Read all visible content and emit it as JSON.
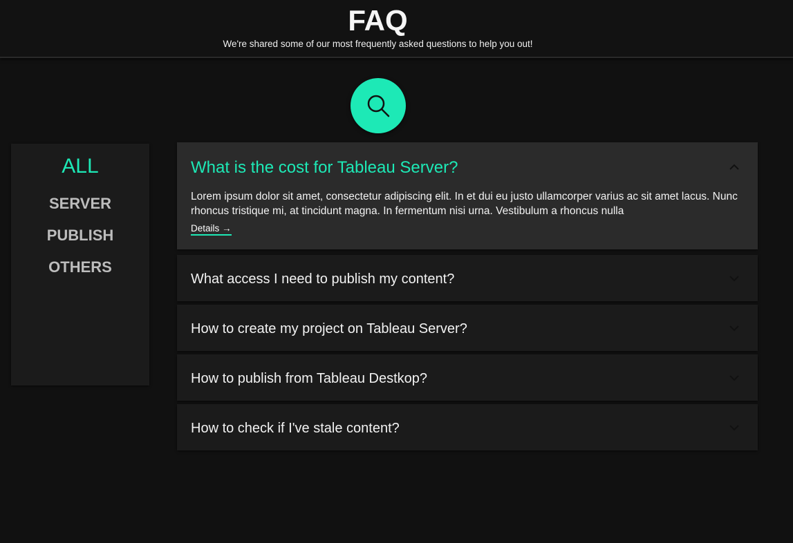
{
  "header": {
    "title": "FAQ",
    "subtitle": "We're shared some of our most frequently asked questions to help you out!"
  },
  "search": {
    "icon": "search-icon",
    "color": "#1de9b6"
  },
  "categories": [
    {
      "label": "ALL",
      "active": true
    },
    {
      "label": "SERVER",
      "active": false
    },
    {
      "label": "PUBLISH",
      "active": false
    },
    {
      "label": "OTHERS",
      "active": false
    }
  ],
  "faqs": [
    {
      "question": "What is the cost for Tableau Server?",
      "expanded": true,
      "answer": "Lorem ipsum dolor sit amet, consectetur adipiscing elit. In et dui eu justo ullamcorper varius ac sit amet lacus. Nunc rhoncus tristique mi, at tincidunt magna. In fermentum nisi urna. Vestibulum a rhoncus nulla",
      "details_label": "Details →"
    },
    {
      "question": "What access I need to publish my content?",
      "expanded": false
    },
    {
      "question": "How to create my project on Tableau Server?",
      "expanded": false
    },
    {
      "question": "How to publish from Tableau Destkop?",
      "expanded": false
    },
    {
      "question": "How to check if I've stale content?",
      "expanded": false
    }
  ],
  "colors": {
    "accent": "#1de9b6",
    "background": "#111111",
    "card": "#1b1b1b",
    "card_open": "#2b2b2b"
  }
}
